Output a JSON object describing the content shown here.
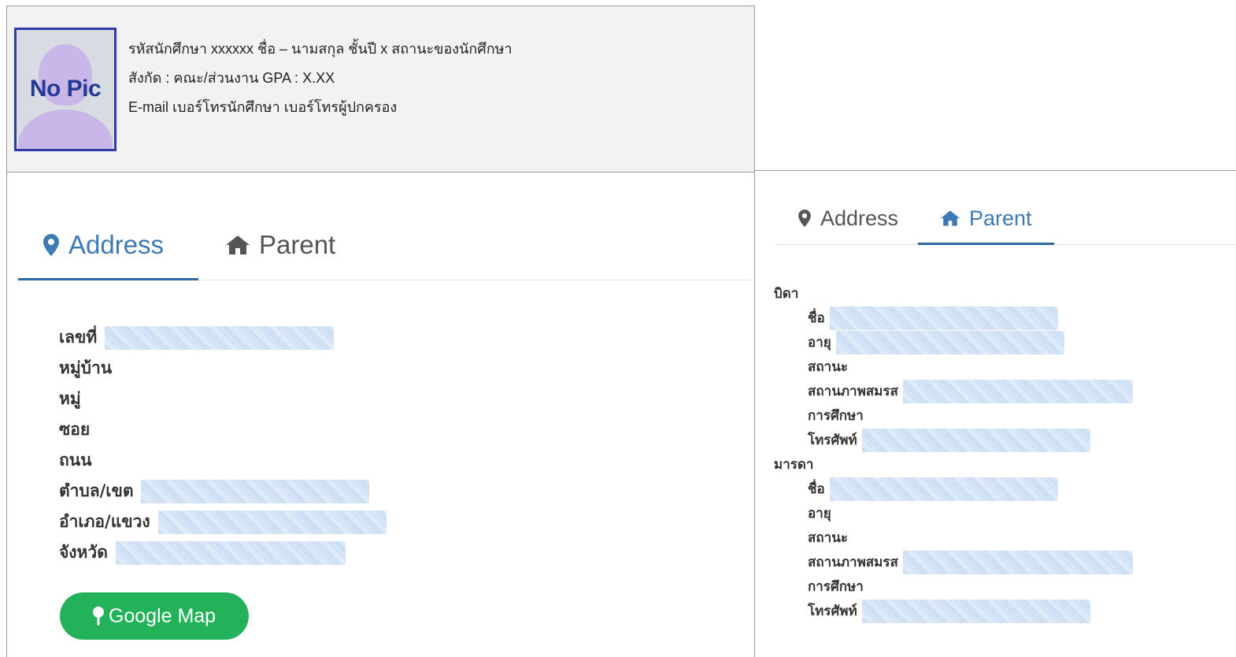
{
  "profile": {
    "avatar_text": "No Pic",
    "line1": "รหัสนักศึกษา xxxxxx  ชื่อ – นามสกุล  ชั้นปี x  สถานะของนักศึกษา",
    "line2": "สังกัด : คณะ/ส่วนงาน   GPA : X.XX",
    "line3": "E-mail  เบอร์โทรนักศึกษา  เบอร์โทรผู้ปกครอง"
  },
  "address_panel": {
    "tabs": [
      {
        "label": "Address",
        "icon": "map-marker-icon",
        "active": true
      },
      {
        "label": "Parent",
        "icon": "home-icon",
        "active": false
      }
    ],
    "fields": [
      {
        "label": "เลขที่",
        "redacted": true
      },
      {
        "label": "หมู่บ้าน",
        "redacted": false
      },
      {
        "label": "หมู่",
        "redacted": false
      },
      {
        "label": "ซอย",
        "redacted": false
      },
      {
        "label": "ถนน",
        "redacted": false
      },
      {
        "label": "ตำบล/เขต",
        "redacted": true
      },
      {
        "label": "อำเภอ/แขวง",
        "redacted": true
      },
      {
        "label": "จังหวัด",
        "redacted": true
      }
    ],
    "map_button": {
      "label": "Google Map",
      "icon": "map-pin-icon",
      "color": "#23b25a"
    }
  },
  "parent_panel": {
    "tabs": [
      {
        "label": "Address",
        "icon": "map-marker-icon",
        "active": false
      },
      {
        "label": "Parent",
        "icon": "home-icon",
        "active": true
      }
    ],
    "father": {
      "title": "บิดา",
      "fields": [
        {
          "label": "ชื่อ",
          "redacted": true
        },
        {
          "label": "อายุ",
          "redacted": true
        },
        {
          "label": "สถานะ",
          "redacted": false
        },
        {
          "label": "สถานภาพสมรส",
          "redacted": true
        },
        {
          "label": "การศึกษา",
          "redacted": false
        },
        {
          "label": "โทรศัพท์",
          "redacted": true
        }
      ]
    },
    "mother": {
      "title": "มารดา",
      "fields": [
        {
          "label": "ชื่อ",
          "redacted": true
        },
        {
          "label": "อายุ",
          "redacted": false
        },
        {
          "label": "สถานะ",
          "redacted": false
        },
        {
          "label": "สถานภาพสมรส",
          "redacted": true
        },
        {
          "label": "การศึกษา",
          "redacted": false
        },
        {
          "label": "โทรศัพท์",
          "redacted": true
        }
      ]
    }
  },
  "colors": {
    "accent": "#3d79b4",
    "tab_underline": "#2f6aa0",
    "button_green": "#23b25a",
    "redaction": "#c9dcf3"
  }
}
